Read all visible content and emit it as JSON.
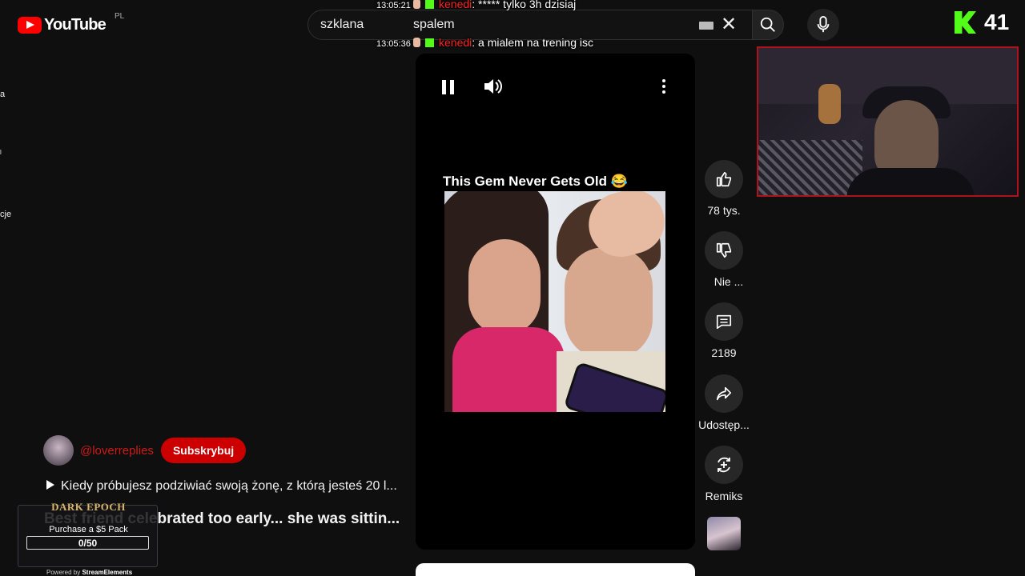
{
  "header": {
    "logo_text": "YouTube",
    "country_code": "PL",
    "search": {
      "query_part1": "szklana",
      "query_part2": "spalem"
    }
  },
  "chat": [
    {
      "time": "13:05:21",
      "user": "kenedi",
      "message": ": ***** tylko 3h dzisiaj"
    },
    {
      "time": "13:05:36",
      "user": "kenedi",
      "message": ": a mialem na trening isc"
    }
  ],
  "kick": {
    "viewer_count": "41",
    "brand_color": "#53fc18"
  },
  "left_nav": {
    "fragments": [
      "a",
      "l",
      "cje"
    ]
  },
  "player": {
    "video_title": "This Gem Never Gets Old 😂",
    "icons": [
      "pause-icon",
      "volume-icon",
      "more-vert-icon"
    ]
  },
  "actions": {
    "like_count": "78 tys.",
    "dislike_label": "Nie ...",
    "comment_count": "2189",
    "share_label": "Udostęp...",
    "remix_label": "Remiks"
  },
  "channel": {
    "name": "@loverreplies",
    "subscribe_label": "Subskrybuj"
  },
  "description": "Kiedy próbujesz podziwiać swoją żonę, z którą jesteś 20 l...",
  "next_title": "Best friend celebrated too early... she was sittin...",
  "stream_elements": {
    "game_title": "DARK EPOCH",
    "goal_text": "Purchase a $5 Pack",
    "progress_text": "0/50",
    "progress_fraction": 0,
    "powered_prefix": "Powered by ",
    "powered_brand": "StreamElements"
  },
  "colors": {
    "accent_red": "#ff0000",
    "subscribe_red": "#cc0000",
    "cam_border": "#b1111a"
  }
}
